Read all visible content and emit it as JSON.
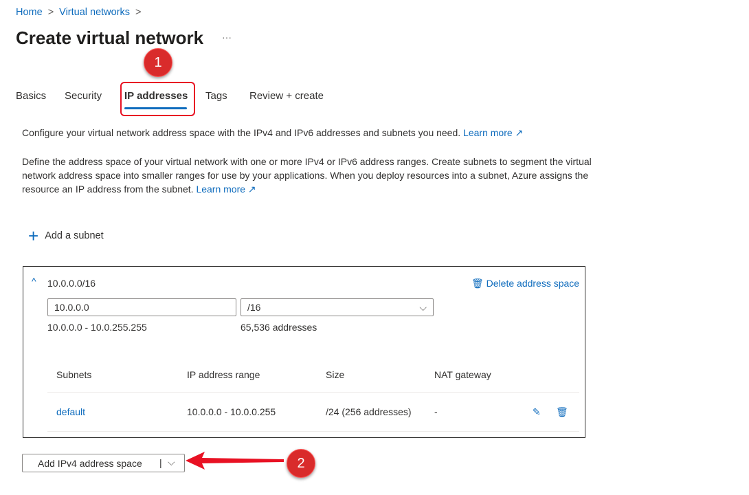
{
  "breadcrumb": [
    "Home",
    "Virtual networks"
  ],
  "title": "Create virtual network",
  "more": "···",
  "tabs": [
    "Basics",
    "Security",
    "IP addresses",
    "Tags",
    "Review + create"
  ],
  "annotations": [
    "1",
    "2"
  ],
  "intro": "Configure your virtual network address space with the IPv4 and IPv6 addresses and subnets you need.",
  "learn_more": "Learn more",
  "description": "Define the address space of your virtual network with one or more IPv4 or IPv6 address ranges. Create subnets to segment the virtual network address space into smaller ranges for use by your applications. When you deploy resources into a subnet, Azure assigns the resource an IP address from the subnet.",
  "add_subnet": "Add a subnet",
  "address_space": {
    "header": "10.0.0.0/16",
    "delete": "Delete address space",
    "ip": "10.0.0.0",
    "prefix": "/16",
    "range": "10.0.0.0 - 10.0.255.255",
    "count": "65,536 addresses"
  },
  "table": {
    "headers": [
      "Subnets",
      "IP address range",
      "Size",
      "NAT gateway"
    ],
    "rows": [
      {
        "name": "default",
        "range": "10.0.0.0 - 10.0.0.255",
        "size": "/24 (256 addresses)",
        "nat": "-"
      }
    ]
  },
  "add_space_button": "Add IPv4 address space",
  "colors": {
    "accent": "#0f6cbd",
    "annotation": "#d92b2b"
  }
}
